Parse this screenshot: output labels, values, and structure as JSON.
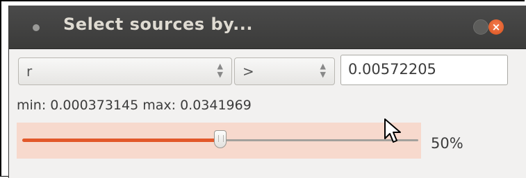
{
  "window": {
    "title": "Select sources by...",
    "close_glyph": "×"
  },
  "filter": {
    "field": "r",
    "operator": ">",
    "value": "0.00572205",
    "range_text": "min: 0.000373145 max: 0.0341969"
  },
  "slider": {
    "fraction": 0.5,
    "percent_label": "50%"
  },
  "icons": {
    "field_arrows": "up-down-arrows",
    "operator_arrows": "up-down-arrows",
    "cursor": "mouse-pointer"
  },
  "colors": {
    "accent": "#e2582a",
    "highlight": "#f7d9cd",
    "titlebar": "#3b3b3a"
  }
}
